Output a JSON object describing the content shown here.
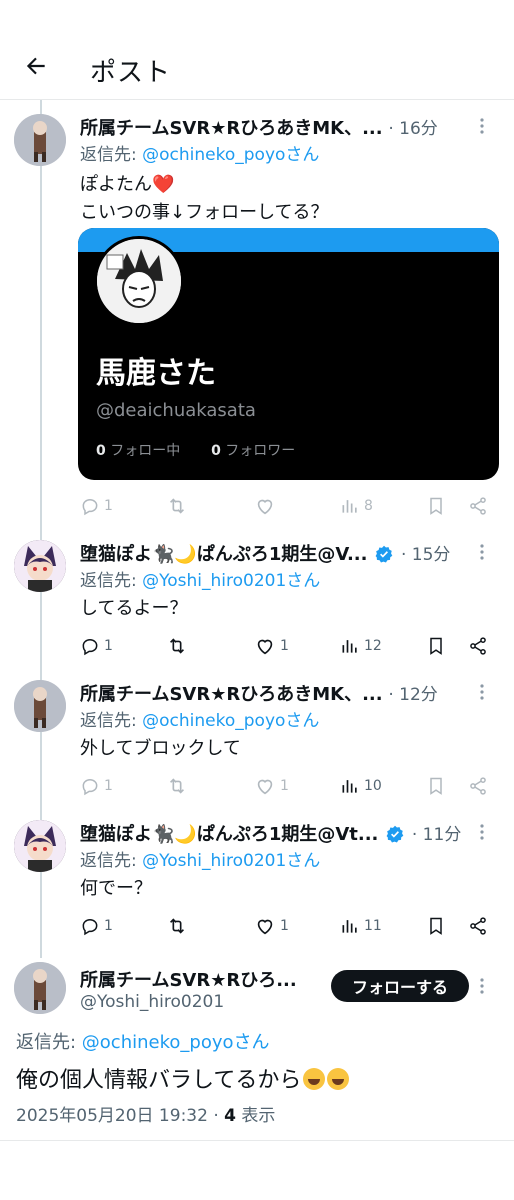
{
  "header": {
    "back_label": "←",
    "title": "ポスト"
  },
  "tweets": [
    {
      "name": "所属チームSVR★RひろあきMK、...",
      "time": "· 16分",
      "reply_prefix": "返信先: ",
      "reply_handle": "@ochineko_poyoさん",
      "text_line1": "ぽよたん❤️",
      "text_line2": "こいつの事↓フォローしてる？",
      "replies": "1",
      "likes": "",
      "views": "8"
    },
    {
      "name": "堕猫ぽよ🐈‍⬛🌙ぱんぷろ1期生@V...",
      "time": "· 15分",
      "reply_prefix": "返信先: ",
      "reply_handle": "@Yoshi_hiro0201さん",
      "text": "してるよー？",
      "replies": "1",
      "likes": "1",
      "views": "12"
    },
    {
      "name": "所属チームSVR★RひろあきMK、...",
      "time": "· 12分",
      "reply_prefix": "返信先: ",
      "reply_handle": "@ochineko_poyoさん",
      "text": "外してブロックして",
      "replies": "1",
      "likes": "1",
      "views": "10"
    },
    {
      "name": "堕猫ぽよ🐈‍⬛🌙ぱんぷろ1期生@Vt...",
      "time": "· 11分",
      "reply_prefix": "返信先: ",
      "reply_handle": "@Yoshi_hiro0201さん",
      "text": "何でー？",
      "replies": "1",
      "likes": "1",
      "views": "11"
    }
  ],
  "card": {
    "name": "馬鹿さた",
    "handle": "@deaichuakasata",
    "following_count": "0",
    "following_label": " フォロー中",
    "followers_count": "0",
    "followers_label": " フォロワー"
  },
  "main": {
    "name": "所属チームSVR★Rひろ...",
    "handle": "@Yoshi_hiro0201",
    "follow_label": "フォローする",
    "reply_prefix": "返信先: ",
    "reply_handle": "@ochineko_poyoさん",
    "text": "俺の個人情報バラしてるから",
    "timestamp": "2025年05月20日 19:32",
    "separator": " · ",
    "view_count": "4",
    "view_label": " 表示"
  },
  "colors": {
    "accent": "#1d9bf0",
    "text": "#0f1419",
    "muted": "#536471",
    "divider": "#e7e9ea"
  },
  "icons": [
    "back-arrow-icon",
    "more-icon",
    "reply-icon",
    "retweet-icon",
    "like-icon",
    "views-icon",
    "bookmark-icon",
    "share-icon",
    "verified-icon"
  ]
}
